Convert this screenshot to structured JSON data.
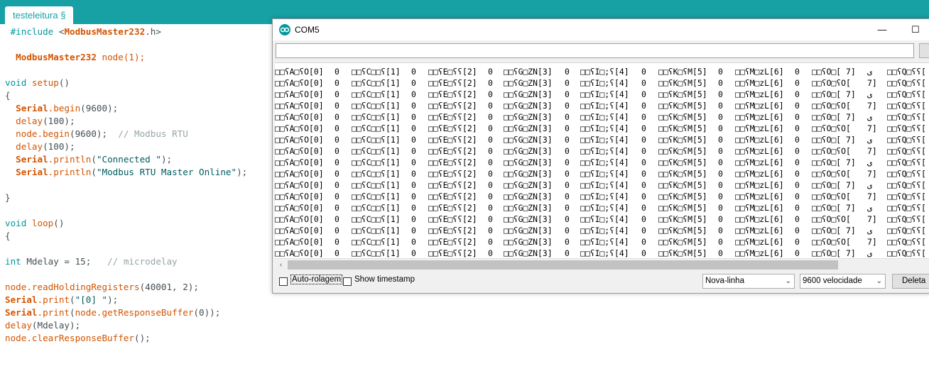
{
  "ide": {
    "tab_label": "testeleitura §",
    "code": {
      "line1_directive": "#include ",
      "line1_lt": "<",
      "line1_lib": "ModbusMaster232",
      "line1_rest": ".h>",
      "line2_type": "ModbusMaster232",
      "line2_rest": " node(1);",
      "setup_kw": "void",
      "setup_name": " setup",
      "setup_parens": "()",
      "open_brace": "{",
      "serial_obj": "Serial",
      "begin_fn": ".begin",
      "begin_arg": "(9600);",
      "delay_fn": "delay",
      "delay_arg": "(100);",
      "node_begin": "node.begin",
      "node_begin_arg": "(9600);",
      "node_begin_cmt": "  // Modbus RTU",
      "println_fn": ".println",
      "connected_str": "\"Connected \"",
      "online_str": "\"Modbus RTU Master Online\"",
      "call_close": ");",
      "close_brace": "}",
      "loop_name": " loop",
      "int_kw": "int",
      "mdelay_decl": " Mdelay = 15;",
      "mdelay_cmt": "   // microdelay",
      "read_regs": "node.readHoldingRegisters",
      "read_regs_arg": "(40001, 2);",
      "print_fn": ".print",
      "print_open": "(",
      "reg0_str": "\"[0] \"",
      "get_buffer": "node.getResponseBuffer",
      "get_buffer_arg": "(0));",
      "delay_mdelay": "(Mdelay);",
      "clear_buffer": "node.clearResponseBuffer",
      "clear_buffer_arg": "();"
    }
  },
  "serial_monitor": {
    "title": "COM5",
    "minimize_label": "—",
    "maximize_label": "☐",
    "send_input_value": "",
    "output_rows_a": [
      "□□ʕA□ʕO[0]",
      "0",
      "□□ʕC□□ʕ[1]",
      "0",
      "□□ʕE□ʕʕ[2]",
      "0",
      "□□ʕG□ZN[3]",
      "0",
      "□□ʕI□;ʕ[4]",
      "0",
      "□□ʕK□ʕM[5]",
      "0",
      "□□ʕM□zL[6]",
      "0",
      "□□ʕO□[ 7]",
      "ى",
      "□□ʕQ□ʕʕ["
    ],
    "output_rows_b": [
      "□□ʕA□ʕO[0]",
      "0",
      "□□ʕC□□ʕ[1]",
      "0",
      "□□ʕE□ʕʕ[2]",
      "0",
      "□□ʕG□ZN[3]",
      "0",
      "□□ʕI□;ʕ[4]",
      "0",
      "□□ʕK□ʕM[5]",
      "0",
      "□□ʕM□zL[6]",
      "0",
      "□□ʕO□ʕO[",
      "7]",
      "□□ʕQ□ʕʕ["
    ],
    "autoscroll_label": "Auto-rolagem",
    "autoscroll_checked": false,
    "timestamp_label": "Show timestamp",
    "timestamp_checked": false,
    "line_ending_value": "Nova-linha",
    "baud_value": "9600 velocidade",
    "clear_label": "Deleta",
    "scroll_left_icon": "‹"
  },
  "colors": {
    "ide_teal": "#17a1a5",
    "keyword_orange": "#d35400",
    "function_teal": "#00979c",
    "string_dark_teal": "#005c5f",
    "comment_gray": "#95a5a6"
  }
}
